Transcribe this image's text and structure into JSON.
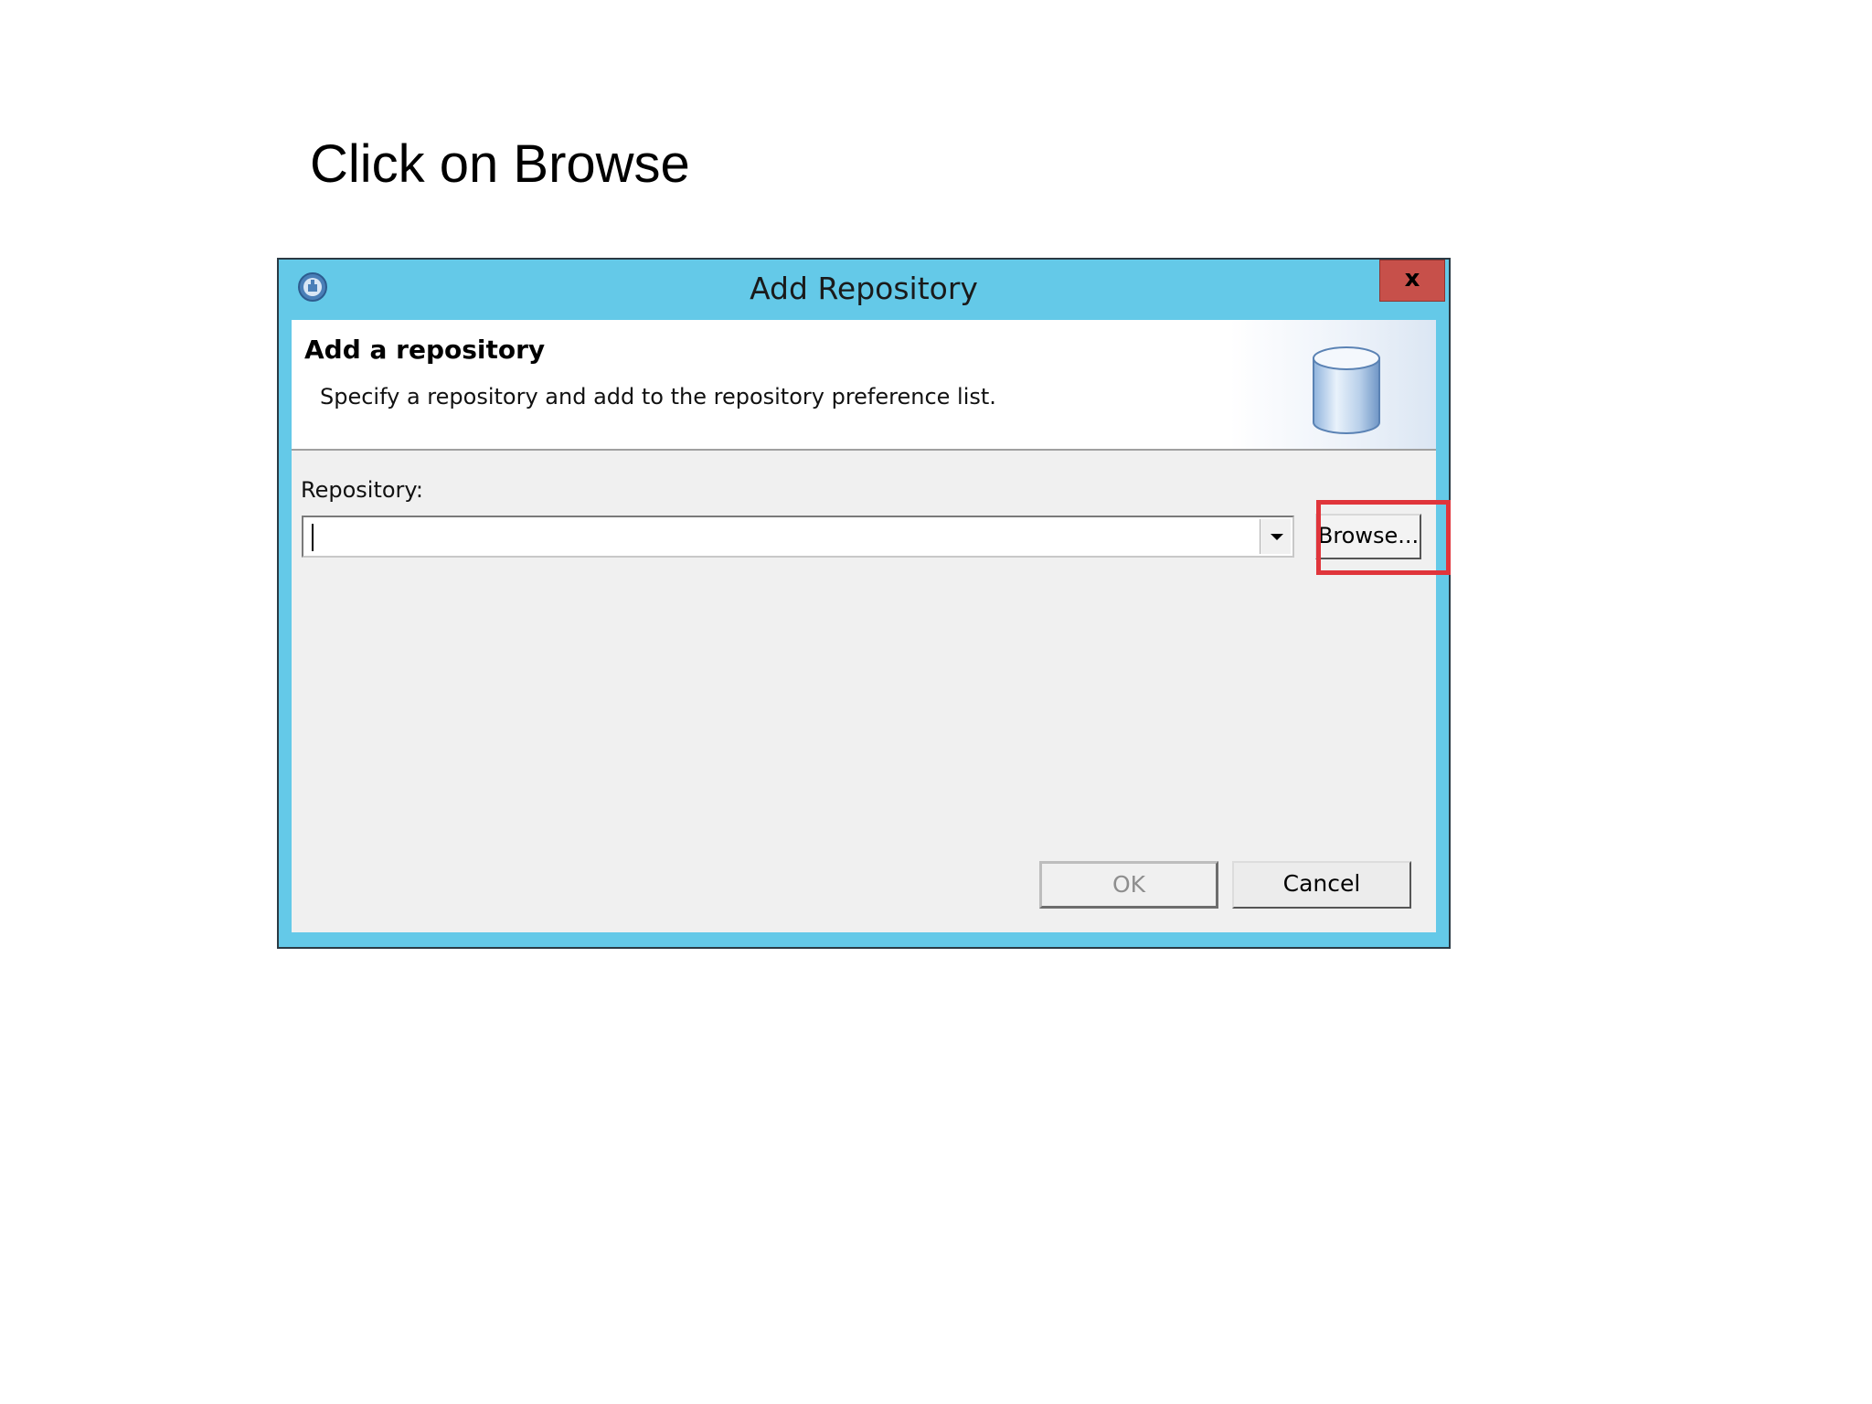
{
  "caption": "Click on Browse",
  "dialog": {
    "title": "Add Repository",
    "close_label": "x",
    "header": {
      "title": "Add a repository",
      "description": "Specify a repository and add to the repository preference list.",
      "icon": "database-icon"
    },
    "repository": {
      "label": "Repository:",
      "value": ""
    },
    "buttons": {
      "browse": "Browse...",
      "ok": "OK",
      "cancel": "Cancel"
    },
    "colors": {
      "window_frame": "#64c9e8",
      "close_button": "#c7504a",
      "highlight": "#e0353b"
    }
  }
}
